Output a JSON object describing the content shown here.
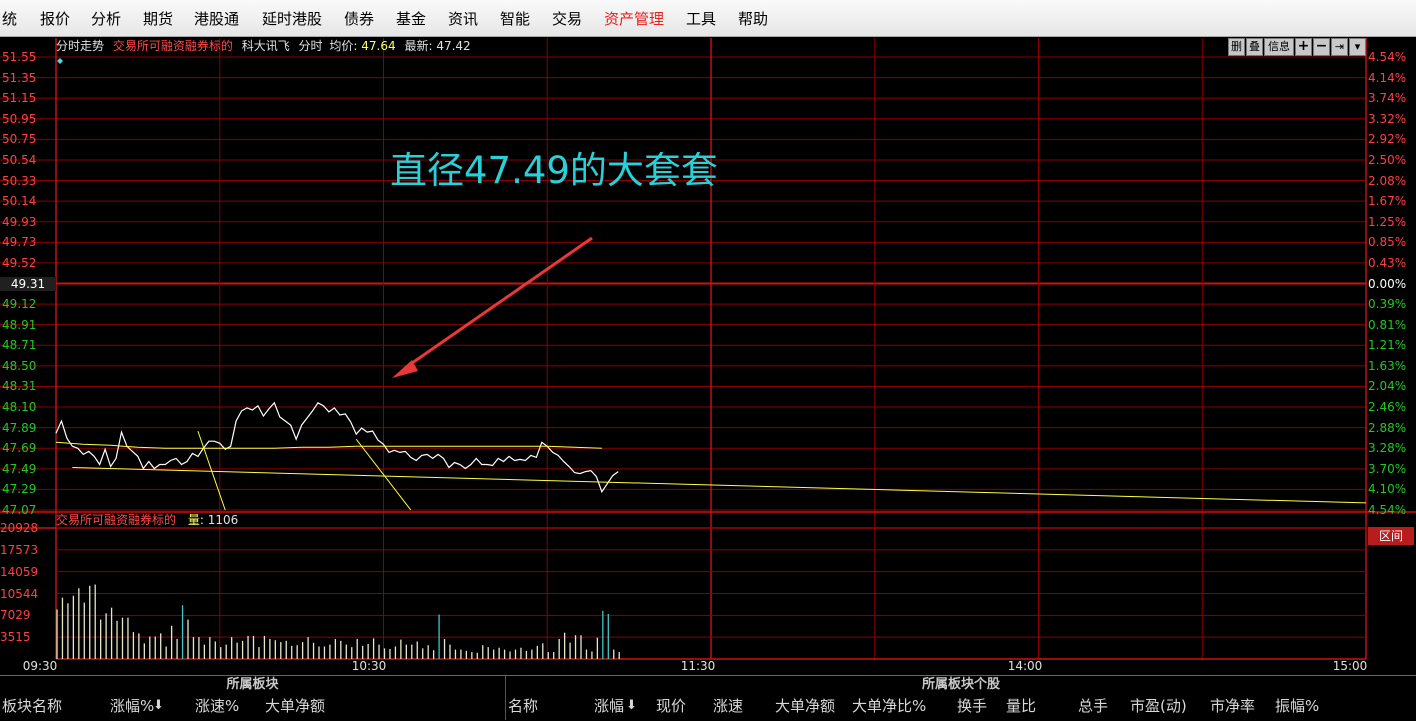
{
  "menu": [
    {
      "label": "统"
    },
    {
      "label": "报价"
    },
    {
      "label": "分析"
    },
    {
      "label": "期货"
    },
    {
      "label": "港股通"
    },
    {
      "label": "延时港股"
    },
    {
      "label": "债券"
    },
    {
      "label": "基金"
    },
    {
      "label": "资讯"
    },
    {
      "label": "智能"
    },
    {
      "label": "交易"
    },
    {
      "label": "资产管理",
      "active": true
    },
    {
      "label": "工具"
    },
    {
      "label": "帮助"
    }
  ],
  "header": {
    "mode": "分时走势",
    "market": "交易所可融资融券标的",
    "stock": "科大讯飞",
    "period": "分时",
    "avg_label": "均价:",
    "avg_value": "47.64",
    "last_label": "最新:",
    "last_value": "47.42"
  },
  "toolbar_buttons": [
    "删",
    "叠",
    "信息",
    "+",
    "−",
    "⇥",
    "▾"
  ],
  "price_axis": {
    "labels": [
      "51.55",
      "51.35",
      "51.15",
      "50.95",
      "50.75",
      "50.54",
      "50.33",
      "50.14",
      "49.93",
      "49.73",
      "49.52",
      "49.31",
      "49.12",
      "48.91",
      "48.71",
      "48.50",
      "48.31",
      "48.10",
      "47.89",
      "47.69",
      "47.49",
      "47.29",
      "47.07"
    ],
    "base": "49.31"
  },
  "pct_axis": {
    "labels": [
      "4.54%",
      "4.14%",
      "3.74%",
      "3.32%",
      "2.92%",
      "2.50%",
      "2.08%",
      "1.67%",
      "1.25%",
      "0.85%",
      "0.43%",
      "0.00%",
      "0.39%",
      "0.81%",
      "1.21%",
      "1.63%",
      "2.04%",
      "2.46%",
      "2.88%",
      "3.28%",
      "3.70%",
      "4.10%",
      "4.54%"
    ]
  },
  "volume": {
    "market": "交易所可融资融券标的",
    "label": "量:",
    "value": "1106",
    "axis": [
      "20928",
      "17573",
      "14059",
      "10544",
      "7029",
      "3515"
    ],
    "button": "区间"
  },
  "time_axis": [
    "09:30",
    "10:30",
    "11:30",
    "14:00",
    "15:00"
  ],
  "annotation": "直径47.49的大套套",
  "colors": {
    "up": "#ff4040",
    "down": "#22c822",
    "price": "#ffffff",
    "avg": "#ffff40",
    "grid": "#8b0000",
    "volume": "#e8e8c8",
    "volume_alt": "#40c8c8"
  },
  "chart_data": {
    "type": "line",
    "x_label_range": [
      "09:30",
      "15:00"
    ],
    "ylim": [
      47.07,
      51.55
    ],
    "reference_price": 49.31,
    "series": [
      {
        "name": "price",
        "values": [
          47.83,
          47.95,
          47.78,
          47.7,
          47.68,
          47.62,
          47.65,
          47.6,
          47.52,
          47.67,
          47.5,
          47.58,
          47.84,
          47.7,
          47.65,
          47.6,
          47.48,
          47.55,
          47.48,
          47.52,
          47.52,
          47.56,
          47.58,
          47.52,
          47.55,
          47.63,
          47.6,
          47.68,
          47.75,
          47.75,
          47.73,
          47.67,
          47.7,
          47.95,
          48.05,
          48.08,
          48.06,
          48.1,
          48.0,
          48.07,
          48.13,
          47.99,
          47.95,
          47.91,
          47.77,
          47.91,
          47.98,
          48.05,
          48.13,
          48.1,
          48.04,
          48.08,
          48.01,
          48.02,
          47.94,
          47.82,
          47.88,
          47.84,
          47.85,
          47.76,
          47.72,
          47.64,
          47.66,
          47.64,
          47.65,
          47.59,
          47.56,
          47.61,
          47.62,
          47.58,
          47.62,
          47.58,
          47.49,
          47.54,
          47.52,
          47.48,
          47.52,
          47.58,
          47.52,
          47.52,
          47.51,
          47.58,
          47.55,
          47.6,
          47.56,
          47.57,
          47.56,
          47.61,
          47.59,
          47.74,
          47.7,
          47.64,
          47.61,
          47.55,
          47.5,
          47.44,
          47.43,
          47.45,
          47.46,
          47.4,
          47.25,
          47.33,
          47.41,
          47.45
        ]
      },
      {
        "name": "average",
        "values": [
          47.74,
          47.72,
          47.71,
          47.69,
          47.68,
          47.68,
          47.68,
          47.68,
          47.68,
          47.69,
          47.69,
          47.7,
          47.7,
          47.7,
          47.7,
          47.7,
          47.7,
          47.7,
          47.7,
          47.69,
          47.68
        ]
      }
    ],
    "trendlines": [
      {
        "from": [
          "09:56",
          47.85
        ],
        "to": [
          "10:01",
          47.07
        ]
      },
      {
        "from": [
          "10:25",
          47.77
        ],
        "to": [
          "10:35",
          47.07
        ]
      },
      {
        "from": [
          "09:33",
          47.49
        ],
        "to": [
          "15:00",
          47.14
        ]
      }
    ],
    "volume_values": [
      7920,
      9800,
      8900,
      10100,
      11300,
      9000,
      11700,
      11900,
      6300,
      7300,
      8200,
      6100,
      6600,
      6600,
      4300,
      4100,
      2500,
      3600,
      3600,
      4100,
      2000,
      5300,
      3200,
      8600,
      6300,
      3500,
      3500,
      2300,
      3500,
      2800,
      1900,
      2300,
      3500,
      2600,
      2900,
      3700,
      3700,
      1900,
      3700,
      3200,
      3000,
      2700,
      2900,
      2100,
      2200,
      2700,
      3500,
      2600,
      2000,
      2000,
      2300,
      3200,
      2900,
      2300,
      1900,
      3200,
      2100,
      2400,
      3300,
      2300,
      1700,
      1600,
      2000,
      3100,
      2300,
      2300,
      2800,
      1700,
      2200,
      1400,
      7100,
      3200,
      2300,
      1500,
      1500,
      1300,
      1100,
      1000,
      2200,
      1900,
      1500,
      1800,
      1500,
      1200,
      1500,
      1800,
      1300,
      1500,
      2100,
      2500,
      1100,
      1100,
      3200,
      4200,
      2600,
      3800,
      3800,
      1500,
      1200,
      3400,
      7700,
      7200,
      1500,
      1100
    ]
  },
  "bottom": {
    "left_title": "所属板块",
    "right_title": "所属板块个股",
    "left_cols": [
      "板块名称",
      "涨幅%",
      "涨速%",
      "大单净额"
    ],
    "right_cols": [
      "名称",
      "涨幅",
      "现价",
      "涨速",
      "大单净额",
      "大单净比%",
      "换手",
      "量比",
      "总手",
      "市盈(动)",
      "市净率",
      "振幅%"
    ]
  }
}
